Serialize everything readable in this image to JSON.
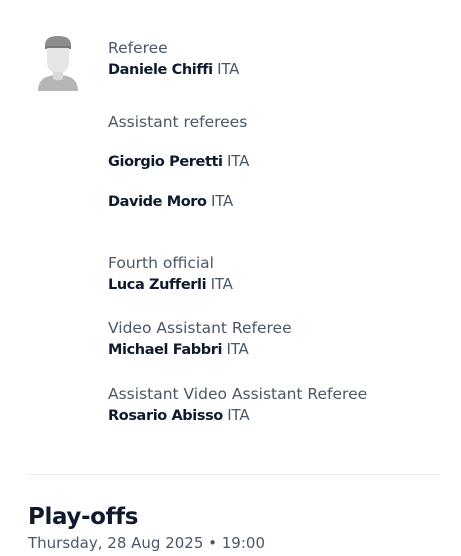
{
  "officials": {
    "referee": {
      "role": "Referee",
      "name": "Daniele Chiffi",
      "nationality": "ITA"
    },
    "assistants_heading": "Assistant referees",
    "assistant_1": {
      "name": "Giorgio Peretti",
      "nationality": "ITA"
    },
    "assistant_2": {
      "name": "Davide Moro",
      "nationality": "ITA"
    },
    "fourth": {
      "role": "Fourth official",
      "name": "Luca Zufferli",
      "nationality": "ITA"
    },
    "var": {
      "role": "Video Assistant Referee",
      "name": "Michael Fabbri",
      "nationality": "ITA"
    },
    "avar": {
      "role": "Assistant Video Assistant Referee",
      "name": "Rosario Abisso",
      "nationality": "ITA"
    }
  },
  "avatar_icon": "person-silhouette-icon",
  "match": {
    "stage": "Play-offs",
    "date": "Thursday, 28 Aug 2025 • 19:00"
  },
  "colors": {
    "text_primary": "#0f1b2d",
    "text_secondary": "#4a5766",
    "avatar_gray": "#b5b5b5",
    "divider": "#e9ecef"
  }
}
